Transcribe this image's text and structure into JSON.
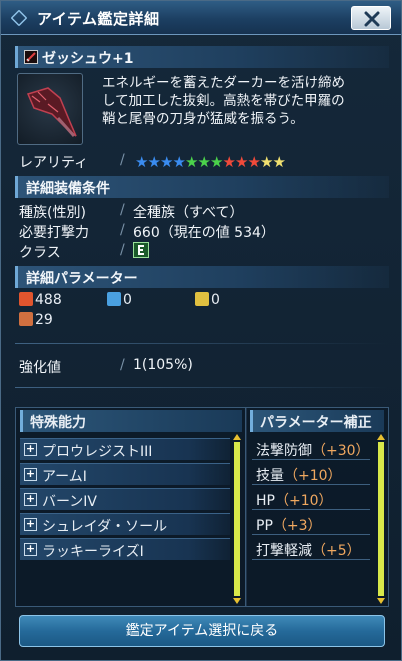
{
  "window": {
    "title": "アイテム鑑定詳細",
    "close_label": "×"
  },
  "item": {
    "name": "ゼッシュウ+1",
    "icon": "dagger-weapon-icon",
    "description_lines": [
      "エネルギーを蓄えたダーカーを活け締め",
      "して加工した抜剣。高熱を帯びた甲羅の",
      "鞘と尾骨の刀身が猛威を振るう。"
    ]
  },
  "rarity": {
    "label": "レアリティ",
    "stars": [
      "#3a8cf0",
      "#3a8cf0",
      "#3a8cf0",
      "#3a8cf0",
      "#4bd24b",
      "#4bd24b",
      "#4bd24b",
      "#f04a3a",
      "#f04a3a",
      "#f04a3a",
      "#f0e070",
      "#f0e070"
    ]
  },
  "requirements": {
    "header": "詳細装備条件",
    "race_label": "種族(性別)",
    "race_value": "全種族（すべて）",
    "power_label": "必要打撃力",
    "power_value": "660（現在の値 534）",
    "class_label": "クラス",
    "class_icon": "hunter-class-icon"
  },
  "parameters": {
    "header": "詳細パラメーター",
    "attack": "488",
    "ranged": "0",
    "tech": "0",
    "defense": "29",
    "colors": {
      "attack": "#e0552e",
      "ranged": "#4aa0e0",
      "tech": "#e0c040",
      "defense": "#d07040"
    }
  },
  "enhance": {
    "label": "強化値",
    "value": "1(105%)"
  },
  "abilities": {
    "header": "特殊能力",
    "items": [
      "プロウレジストIII",
      "アームI",
      "バーンIV",
      "シュレイダ・ソール",
      "ラッキーライズI"
    ]
  },
  "bonuses": {
    "header": "パラメーター補正",
    "items": [
      {
        "name": "法撃防御",
        "value": "（+30）"
      },
      {
        "name": "技量",
        "value": "（+10）"
      },
      {
        "name": "HP",
        "value": "（+10）"
      },
      {
        "name": "PP",
        "value": "（+3）"
      },
      {
        "name": "打撃軽減",
        "value": "（+5）"
      }
    ]
  },
  "footer": {
    "back_label": "鑑定アイテム選択に戻る"
  }
}
